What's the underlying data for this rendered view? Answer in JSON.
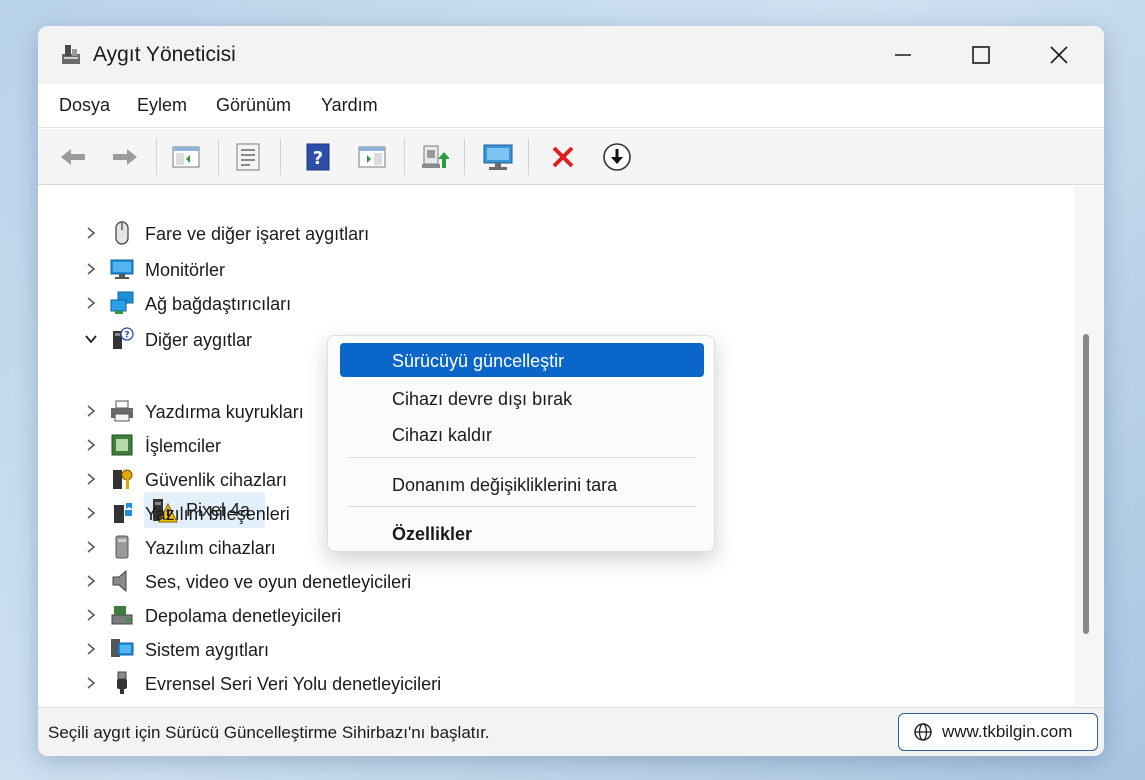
{
  "window": {
    "title": "Aygıt Yöneticisi"
  },
  "menu": [
    "Dosya",
    "Eylem",
    "Görünüm",
    "Yardım"
  ],
  "toolbar": {
    "icons": [
      "back-arrow-icon",
      "forward-arrow-icon",
      "show-hide-console-tree-icon",
      "properties-icon",
      "help-icon",
      "action-pane-icon",
      "update-driver-icon",
      "scan-hardware-icon",
      "uninstall-icon",
      "disable-device-icon"
    ]
  },
  "tree": {
    "items": [
      {
        "label": "Fare ve diğer işaret aygıtları",
        "icon": "mouse-icon",
        "expanded": false
      },
      {
        "label": "Monitörler",
        "icon": "monitor-icon",
        "expanded": false
      },
      {
        "label": "Ağ bağdaştırıcıları",
        "icon": "network-adapter-icon",
        "expanded": false
      },
      {
        "label": "Diğer aygıtlar",
        "icon": "unknown-device-icon",
        "expanded": true
      },
      {
        "label": "Pixel 4a",
        "icon": "warning-device-icon",
        "child": true
      },
      {
        "label": "Yazdırma kuyrukları",
        "icon": "printer-icon",
        "expanded": false
      },
      {
        "label": "İşlemciler",
        "icon": "processor-icon",
        "expanded": false
      },
      {
        "label": "Güvenlik cihazları",
        "icon": "security-key-icon",
        "expanded": false
      },
      {
        "label": "Yazılım bileşenleri",
        "icon": "software-component-icon",
        "expanded": false
      },
      {
        "label": "Yazılım cihazları",
        "icon": "software-device-icon",
        "expanded": false
      },
      {
        "label": "Ses, video ve oyun denetleyicileri",
        "icon": "speaker-icon",
        "expanded": false
      },
      {
        "label": "Depolama denetleyicileri",
        "icon": "storage-controller-icon",
        "expanded": false
      },
      {
        "label": "Sistem aygıtları",
        "icon": "system-device-icon",
        "expanded": false
      },
      {
        "label": "Evrensel Seri Veri Yolu denetleyicileri",
        "icon": "usb-icon",
        "expanded": false
      }
    ]
  },
  "context_menu": {
    "items": [
      {
        "label": "Sürücüyü güncelleştir",
        "active": true
      },
      {
        "label": "Cihazı devre dışı bırak"
      },
      {
        "label": "Cihazı kaldır"
      },
      {
        "label": "Donanım değişikliklerini tara"
      },
      {
        "label": "Özellikler",
        "bold": true
      }
    ]
  },
  "status": {
    "text": "Seçili aygıt için Sürücü Güncelleştirme Sihirbazı'nı başlatır.",
    "site": "www.tkbilgin.com"
  },
  "colors": {
    "accent": "#0a67c9",
    "selection": "#e3effb"
  }
}
